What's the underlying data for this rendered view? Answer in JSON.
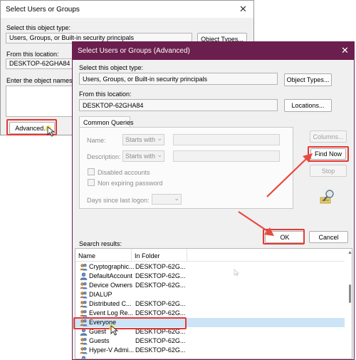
{
  "back_dialog": {
    "title": "Select Users or Groups",
    "object_type_label": "Select this object type:",
    "object_type_value": "Users, Groups, or Built-in security principals",
    "object_types_button": "Object Types...",
    "location_label": "From this location:",
    "location_value": "DESKTOP-62GHA84",
    "enter_names_label": "Enter the object names to",
    "advanced_button": "Advanced..."
  },
  "adv_dialog": {
    "title": "Select Users or Groups (Advanced)",
    "object_type_label": "Select this object type:",
    "object_type_value": "Users, Groups, or Built-in security principals",
    "object_types_button": "Object Types...",
    "location_label": "From this location:",
    "location_value": "DESKTOP-62GHA84",
    "locations_button": "Locations...",
    "tab_common_queries": "Common Queries",
    "name_label": "Name:",
    "name_mode": "Starts with",
    "description_label": "Description:",
    "description_mode": "Starts with",
    "disabled_accounts": "Disabled accounts",
    "non_expiring_password": "Non expiring password",
    "days_since_logon": "Days since last logon:",
    "columns_button": "Columns...",
    "find_now_button": "Find Now",
    "stop_button": "Stop",
    "ok_button": "OK",
    "cancel_button": "Cancel",
    "search_results_label": "Search results:"
  },
  "results": {
    "columns": [
      "Name",
      "In Folder"
    ],
    "rows": [
      {
        "name": "Cryptographic...",
        "folder": "DESKTOP-62G..."
      },
      {
        "name": "DefaultAccount",
        "folder": "DESKTOP-62G..."
      },
      {
        "name": "Device Owners",
        "folder": "DESKTOP-62G..."
      },
      {
        "name": "DIALUP",
        "folder": ""
      },
      {
        "name": "Distributed C...",
        "folder": "DESKTOP-62G..."
      },
      {
        "name": "Event Log Re...",
        "folder": "DESKTOP-62G..."
      },
      {
        "name": "Everyone",
        "folder": ""
      },
      {
        "name": "Guest",
        "folder": "DESKTOP-62G..."
      },
      {
        "name": "Guests",
        "folder": "DESKTOP-62G..."
      },
      {
        "name": "Hyper-V Admi...",
        "folder": "DESKTOP-62G..."
      },
      {
        "name": "",
        "folder": ""
      }
    ]
  },
  "colors": {
    "title_bar_active": "#6b1f4e",
    "highlight_red": "#e53935",
    "arrow_red": "#e84a3f",
    "selection": "#cce4f7"
  },
  "icons": {
    "close": "close-icon",
    "user": "user-icon",
    "group": "group-icon",
    "search": "search-icon",
    "cursor": "mouse-cursor-icon"
  }
}
